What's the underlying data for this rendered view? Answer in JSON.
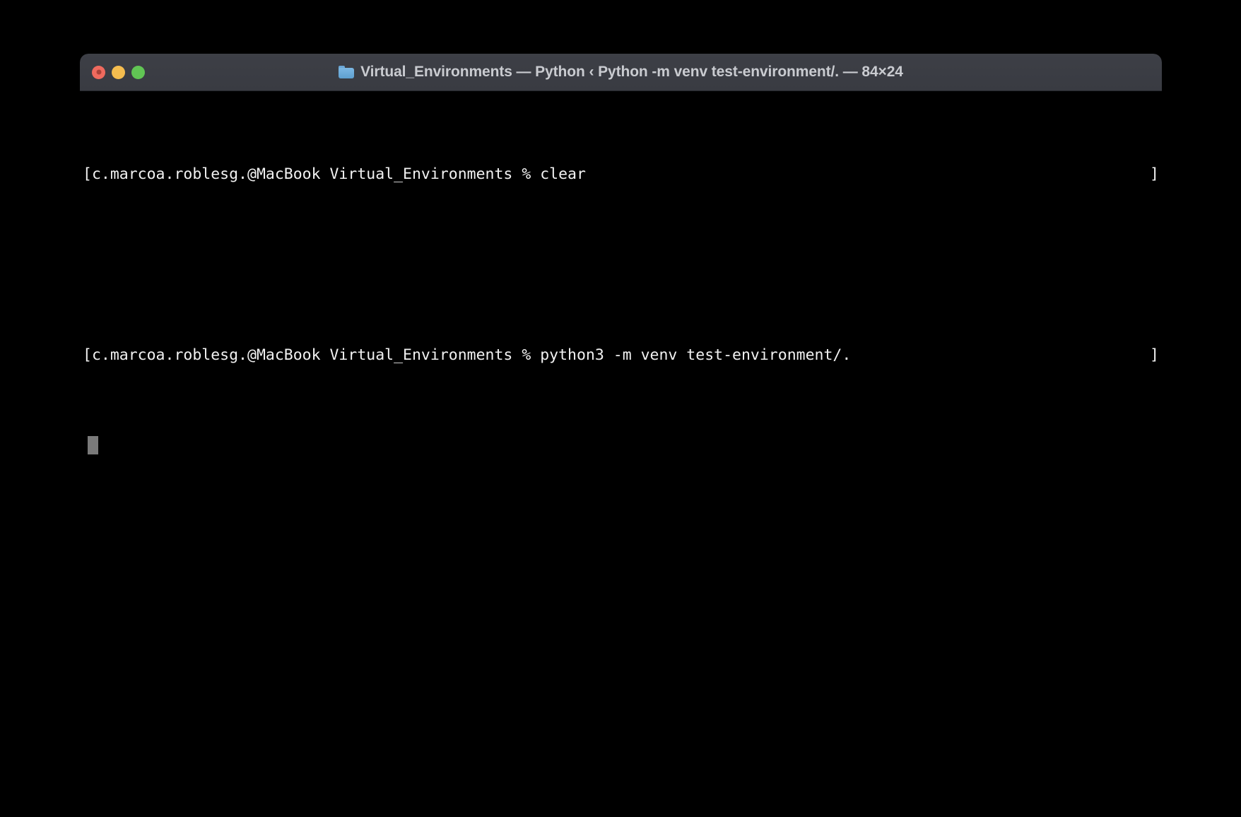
{
  "window": {
    "app": "Terminal",
    "title_full": "Virtual_Environments — Python ‹ Python -m venv test-environment/. — 84×24",
    "folder_name": "Virtual_Environments",
    "size_label": "84×24",
    "traffic_lights": {
      "close_label": "Close",
      "minimize_label": "Minimize",
      "zoom_label": "Zoom"
    }
  },
  "terminal": {
    "colors": {
      "background": "#000000",
      "foreground": "#f2f2f2",
      "titlebar": "#3d3f46",
      "cursor": "#7a7a7a",
      "close": "#ef6a5e",
      "minimize": "#f5bd4f",
      "maximize": "#61c554"
    },
    "prompt": "[c.marcoa.roblesg.@MacBook Virtual_Environments % ",
    "lines": [
      {
        "id": "line-1",
        "text": "[c.marcoa.roblesg.@MacBook Virtual_Environments % clear",
        "right_marker": "]"
      },
      {
        "id": "line-2-blank",
        "text": "",
        "right_marker": ""
      },
      {
        "id": "line-3",
        "text": "[c.marcoa.roblesg.@MacBook Virtual_Environments % python3 -m venv test-environment/. ",
        "right_marker": "]"
      }
    ],
    "cursor_row": 3,
    "cursor_col": 1
  }
}
